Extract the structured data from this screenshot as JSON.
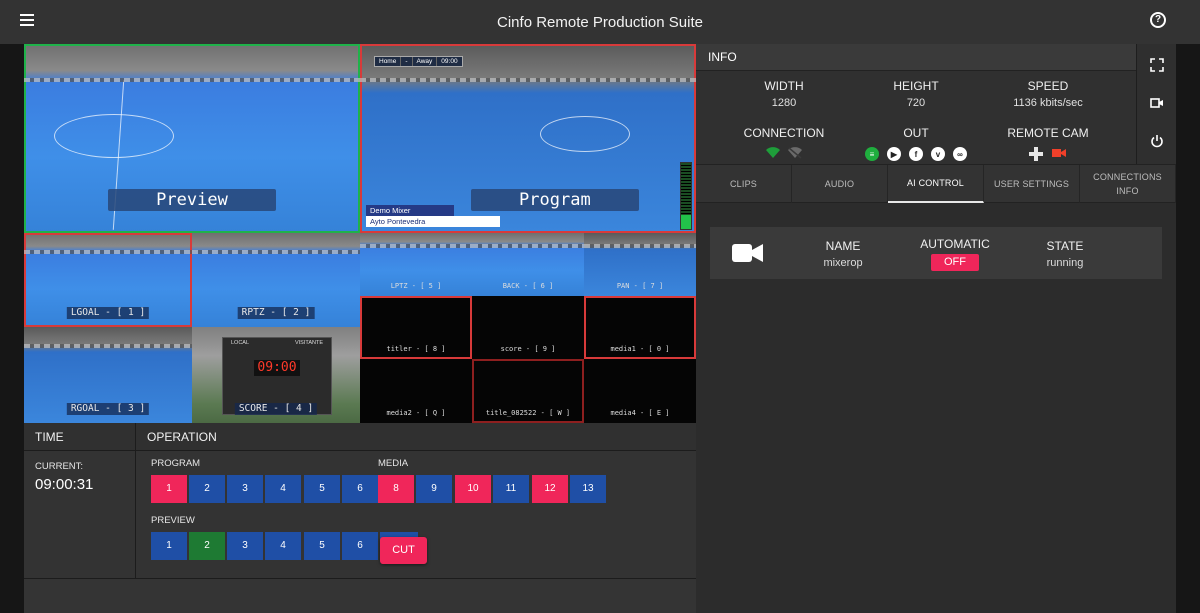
{
  "app": {
    "title": "Cinfo Remote Production Suite"
  },
  "icons": {
    "menu": "menu-icon",
    "help": "help-icon",
    "fullscreen": "fullscreen-icon",
    "camera": "videocam-icon",
    "power": "power-icon"
  },
  "multiview": {
    "preview_label": "Preview",
    "program_label": "Program",
    "program_overlay": {
      "home": "Home",
      "dash": "-",
      "away": "Away",
      "clock": "09:00",
      "lower_third_1": "Demo Mixer",
      "lower_third_2": "Ayto Pontevedra"
    },
    "sources": [
      {
        "label": "LGOAL - [ 1 ]"
      },
      {
        "label": "RPTZ - [ 2 ]"
      },
      {
        "label": "RGOAL - [ 3 ]"
      },
      {
        "label": "SCORE - [ 4 ]"
      },
      {
        "label": "LPTZ - [ 5 ]"
      },
      {
        "label": "BACK - [ 6 ]"
      },
      {
        "label": "PAN - [ 7 ]"
      },
      {
        "label": "titler - [ 8 ]"
      },
      {
        "label": "score - [ 9 ]"
      },
      {
        "label": "media1 - [ 0 ]"
      },
      {
        "label": "media2 - [ Q ]"
      },
      {
        "label": "title_082522 - [ W ]"
      },
      {
        "label": "media4 - [ E ]"
      }
    ],
    "scoreboard": {
      "local": "LOCAL",
      "visitor": "VISITANTE",
      "clock": "09:00"
    }
  },
  "info": {
    "header": "INFO",
    "width_label": "WIDTH",
    "width_value": "1280",
    "height_label": "HEIGHT",
    "height_value": "720",
    "speed_label": "SPEED",
    "speed_value": "1136 kbits/sec",
    "connection_label": "CONNECTION",
    "out_label": "OUT",
    "remote_cam_label": "REMOTE CAM"
  },
  "tabs": [
    {
      "label": "CLIPS"
    },
    {
      "label": "AUDIO"
    },
    {
      "label": "AI CONTROL"
    },
    {
      "label": "USER SETTINGS"
    },
    {
      "label": "CONNECTIONS INFO"
    }
  ],
  "ai_control": {
    "name_label": "NAME",
    "name_value": "mixerop",
    "automatic_label": "AUTOMATIC",
    "automatic_value": "OFF",
    "state_label": "STATE",
    "state_value": "running"
  },
  "time": {
    "header": "TIME",
    "current_label": "CURRENT:",
    "current_value": "09:00:31"
  },
  "operation": {
    "header": "OPERATION",
    "program_label": "PROGRAM",
    "media_label": "MEDIA",
    "preview_label": "PREVIEW",
    "program_buttons": [
      "1",
      "2",
      "3",
      "4",
      "5",
      "6"
    ],
    "media_buttons": [
      "8",
      "9",
      "10",
      "11",
      "12",
      "13"
    ],
    "preview_buttons": [
      "1",
      "2",
      "3",
      "4",
      "5",
      "6"
    ],
    "cut_label": "CUT"
  },
  "colors": {
    "accent_red": "#f0265a",
    "button_blue": "#1f4fa6",
    "button_green": "#1e7a33",
    "tally_green": "#1fb24a",
    "tally_red": "#d83a3a"
  }
}
